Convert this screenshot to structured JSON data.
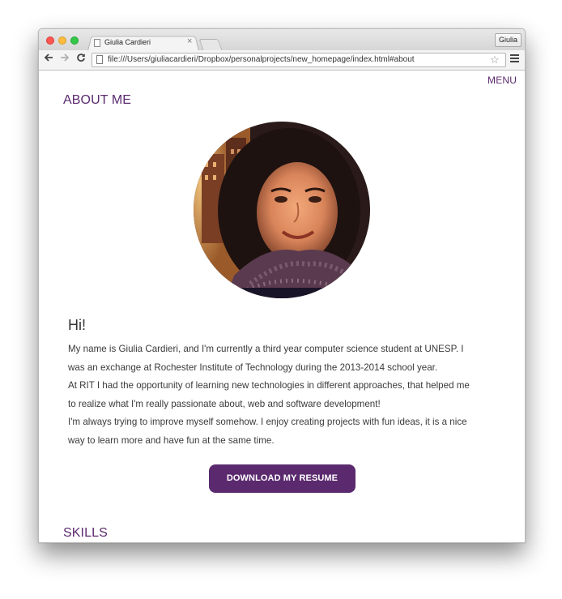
{
  "browser": {
    "tab_title": "Giulia Cardieri",
    "tab_close": "×",
    "profile_name": "Giulia",
    "url": "file:///Users/giuliacardieri/Dropbox/personalprojects/new_homepage/index.html#about",
    "icons": {
      "back": "back-arrow-icon",
      "forward": "forward-arrow-icon",
      "reload": "reload-icon",
      "star": "star-icon",
      "menu": "hamburger-menu-icon"
    }
  },
  "page": {
    "menu_label": "MENU",
    "about_title": "ABOUT ME",
    "greeting": "Hi!",
    "bio": [
      "My name is Giulia Cardieri, and I'm currently a third year computer science student at UNESP. I",
      "was an exchange at Rochester Institute of Technology during the 2013-2014 school year.",
      "At RIT I had the opportunity of learning new technologies in different approaches, that helped me",
      "to realize what I'm really passionate about, web and software development!",
      "I'm always trying to improve myself somehow. I enjoy creating projects with fun ideas, it is a nice",
      "way to learn more and have fun at the same time."
    ],
    "resume_button": "DOWNLOAD MY RESUME",
    "skills_title": "SKILLS"
  },
  "colors": {
    "accent": "#5b2a6e",
    "text": "#3a3a3a"
  }
}
